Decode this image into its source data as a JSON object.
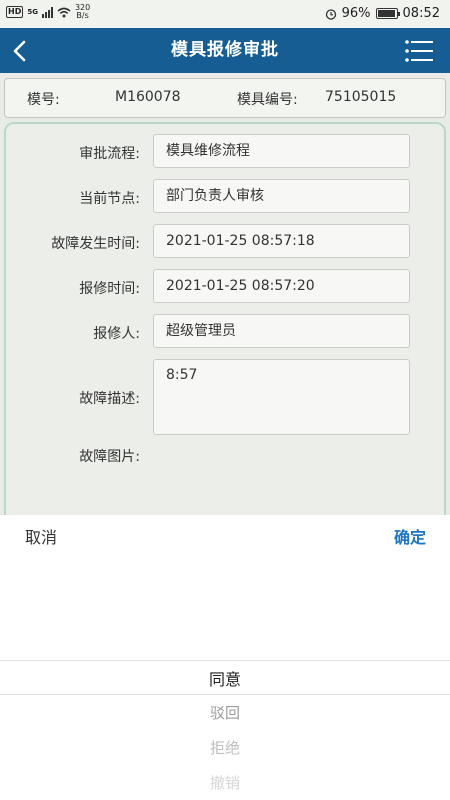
{
  "status_bar": {
    "network": "HD",
    "network_gen": "5G",
    "speed_value": "320",
    "speed_unit": "B/s",
    "battery": "96%",
    "time": "08:52"
  },
  "header": {
    "title": "模具报修审批"
  },
  "mold_info": {
    "model_label": "模号:",
    "model_value": "M160078",
    "code_label": "模具编号:",
    "code_value": "75105015"
  },
  "form": {
    "process_label": "审批流程:",
    "process_value": "模具维修流程",
    "node_label": "当前节点:",
    "node_value": "部门负责人审核",
    "fault_time_label": "故障发生时间:",
    "fault_time_value": "2021-01-25 08:57:18",
    "report_time_label": "报修时间:",
    "report_time_value": "2021-01-25 08:57:20",
    "reporter_label": "报修人:",
    "reporter_value": "超级管理员",
    "desc_label": "故障描述:",
    "desc_value": "8:57",
    "image_label": "故障图片:"
  },
  "picker": {
    "cancel_label": "取消",
    "confirm_label": "确定",
    "options": [
      "同意",
      "驳回",
      "拒绝",
      "撤销"
    ]
  }
}
